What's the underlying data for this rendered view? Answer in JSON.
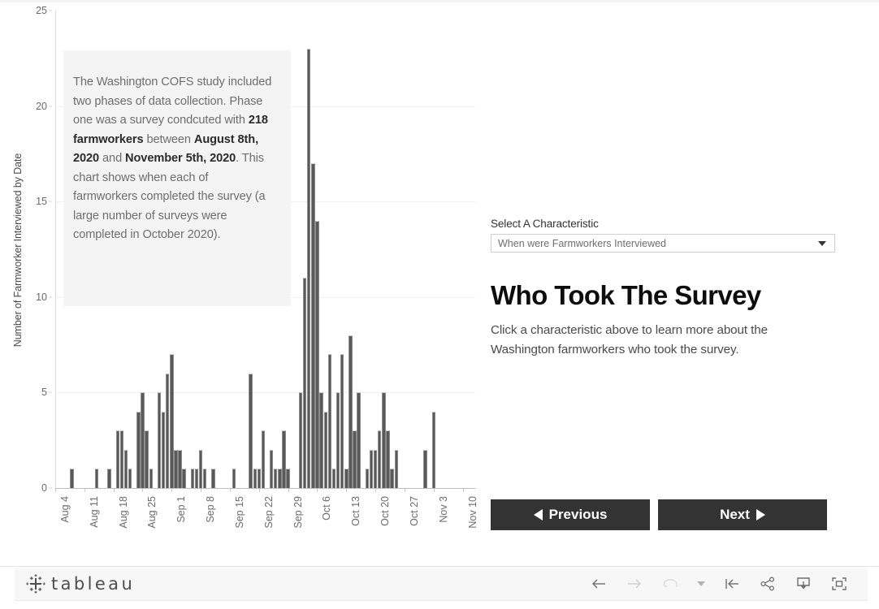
{
  "annotation": {
    "segments": [
      {
        "t": "The Washington COFS study included two phases of data collection. Phase one was a survey condcuted with ",
        "b": false
      },
      {
        "t": "218 farmworkers",
        "b": true
      },
      {
        "t": " between ",
        "b": false
      },
      {
        "t": "August 8th, 2020",
        "b": true
      },
      {
        "t": " and ",
        "b": false
      },
      {
        "t": "November 5th, 2020",
        "b": true
      },
      {
        "t": ". This chart shows when each of farmworkers completed the survey (a large number of surveys were completed in October 2020).",
        "b": false
      }
    ],
    "plain": "The Washington COFS study included two phases of data collection. Phase one was a survey condcuted with 218 farmworkers between August 8th, 2020 and November 5th, 2020. This chart shows when each of farmworkers completed the survey (a large number of surveys were completed in October 2020)."
  },
  "panel": {
    "select_label": "Select A Characteristic",
    "select_value": "When were Farmworkers Interviewed",
    "select_options": [
      "When were Farmworkers Interviewed"
    ],
    "title": "Who Took The Survey",
    "subtitle": "Click a characteristic above to learn more about the Washington farmworkers who took the survey.",
    "prev_label": "Previous",
    "next_label": "Next"
  },
  "footer": {
    "brand": "tableau",
    "icons": [
      {
        "name": "back-arrow-icon",
        "glyph": "arrow-left",
        "disabled": false
      },
      {
        "name": "forward-arrow-icon",
        "glyph": "arrow-right",
        "disabled": true
      },
      {
        "name": "revert-icon",
        "glyph": "revert",
        "disabled": true
      },
      {
        "name": "revert-dropdown-caret-icon",
        "glyph": "caret",
        "disabled": true
      },
      {
        "name": "reset-to-start-icon",
        "glyph": "reset",
        "disabled": false
      },
      {
        "name": "share-icon",
        "glyph": "share",
        "disabled": false
      },
      {
        "name": "download-icon",
        "glyph": "download",
        "disabled": false
      },
      {
        "name": "fullscreen-icon",
        "glyph": "fullscreen",
        "disabled": false
      }
    ]
  },
  "colors": {
    "bar": "#595959",
    "bar_edge": "#8c8c8c",
    "button": "#333333",
    "annotation_bg": "#f4f4f4",
    "gridline": "#f0f0f0",
    "axis": "#d6d6d6",
    "tick_text": "#6b6b6b"
  },
  "chart_data": {
    "type": "bar",
    "title": "",
    "xlabel": "",
    "ylabel": "Number of Farmworker Interviewed by Date",
    "ylim": [
      0,
      25
    ],
    "yticks": [
      0,
      5,
      10,
      15,
      20,
      25
    ],
    "grid": true,
    "legend": null,
    "x_tick_labels": [
      "Aug 4",
      "Aug 11",
      "Aug 18",
      "Aug 25",
      "Sep 1",
      "Sep 8",
      "Sep 15",
      "Sep 22",
      "Sep 29",
      "Oct 6",
      "Oct 13",
      "Oct 20",
      "Oct 27",
      "Nov 3",
      "Nov 10"
    ],
    "x_tick_days": [
      0,
      7,
      14,
      21,
      28,
      35,
      42,
      49,
      56,
      63,
      70,
      77,
      84,
      91,
      98
    ],
    "x_domain_days": [
      0,
      101
    ],
    "x_unit": "day index from Aug 4, 2020",
    "values": [
      {
        "day": 4,
        "label": "Aug 8",
        "v": 1
      },
      {
        "day": 10,
        "label": "Aug 14",
        "v": 1
      },
      {
        "day": 13,
        "label": "Aug 17",
        "v": 1
      },
      {
        "day": 15,
        "label": "Aug 19",
        "v": 3
      },
      {
        "day": 16,
        "label": "Aug 20",
        "v": 3
      },
      {
        "day": 17,
        "label": "Aug 21",
        "v": 2
      },
      {
        "day": 18,
        "label": "Aug 22",
        "v": 1
      },
      {
        "day": 20,
        "label": "Aug 24",
        "v": 4
      },
      {
        "day": 21,
        "label": "Aug 25",
        "v": 5
      },
      {
        "day": 22,
        "label": "Aug 26",
        "v": 3
      },
      {
        "day": 23,
        "label": "Aug 27",
        "v": 1
      },
      {
        "day": 25,
        "label": "Aug 29",
        "v": 5
      },
      {
        "day": 26,
        "label": "Aug 30",
        "v": 4
      },
      {
        "day": 27,
        "label": "Aug 31",
        "v": 6
      },
      {
        "day": 28,
        "label": "Sep 1",
        "v": 7
      },
      {
        "day": 29,
        "label": "Sep 2",
        "v": 2
      },
      {
        "day": 30,
        "label": "Sep 3",
        "v": 2
      },
      {
        "day": 31,
        "label": "Sep 4",
        "v": 1
      },
      {
        "day": 33,
        "label": "Sep 6",
        "v": 1
      },
      {
        "day": 34,
        "label": "Sep 7",
        "v": 1
      },
      {
        "day": 35,
        "label": "Sep 8",
        "v": 2
      },
      {
        "day": 36,
        "label": "Sep 9",
        "v": 1
      },
      {
        "day": 38,
        "label": "Sep 11",
        "v": 1
      },
      {
        "day": 43,
        "label": "Sep 16",
        "v": 1
      },
      {
        "day": 47,
        "label": "Sep 20",
        "v": 6
      },
      {
        "day": 48,
        "label": "Sep 21",
        "v": 1
      },
      {
        "day": 49,
        "label": "Sep 22",
        "v": 1
      },
      {
        "day": 50,
        "label": "Sep 23",
        "v": 3
      },
      {
        "day": 52,
        "label": "Sep 25",
        "v": 2
      },
      {
        "day": 53,
        "label": "Sep 26",
        "v": 1
      },
      {
        "day": 54,
        "label": "Sep 27",
        "v": 1
      },
      {
        "day": 55,
        "label": "Sep 28",
        "v": 3
      },
      {
        "day": 56,
        "label": "Sep 29",
        "v": 1
      },
      {
        "day": 59,
        "label": "Oct 2",
        "v": 5
      },
      {
        "day": 60,
        "label": "Oct 3",
        "v": 11
      },
      {
        "day": 61,
        "label": "Oct 4",
        "v": 23
      },
      {
        "day": 62,
        "label": "Oct 5",
        "v": 17
      },
      {
        "day": 63,
        "label": "Oct 6",
        "v": 14
      },
      {
        "day": 64,
        "label": "Oct 7",
        "v": 5
      },
      {
        "day": 65,
        "label": "Oct 8",
        "v": 4
      },
      {
        "day": 66,
        "label": "Oct 9",
        "v": 7
      },
      {
        "day": 67,
        "label": "Oct 10",
        "v": 1
      },
      {
        "day": 68,
        "label": "Oct 11",
        "v": 5
      },
      {
        "day": 69,
        "label": "Oct 12",
        "v": 7
      },
      {
        "day": 70,
        "label": "Oct 13",
        "v": 1
      },
      {
        "day": 71,
        "label": "Oct 14",
        "v": 8
      },
      {
        "day": 72,
        "label": "Oct 15",
        "v": 3
      },
      {
        "day": 73,
        "label": "Oct 16",
        "v": 5
      },
      {
        "day": 75,
        "label": "Oct 18",
        "v": 1
      },
      {
        "day": 76,
        "label": "Oct 19",
        "v": 2
      },
      {
        "day": 77,
        "label": "Oct 20",
        "v": 2
      },
      {
        "day": 78,
        "label": "Oct 21",
        "v": 3
      },
      {
        "day": 79,
        "label": "Oct 22",
        "v": 5
      },
      {
        "day": 80,
        "label": "Oct 23",
        "v": 3
      },
      {
        "day": 81,
        "label": "Oct 24",
        "v": 1
      },
      {
        "day": 82,
        "label": "Oct 25",
        "v": 2
      },
      {
        "day": 89,
        "label": "Nov 1",
        "v": 2
      },
      {
        "day": 91,
        "label": "Nov 3",
        "v": 4
      }
    ]
  }
}
